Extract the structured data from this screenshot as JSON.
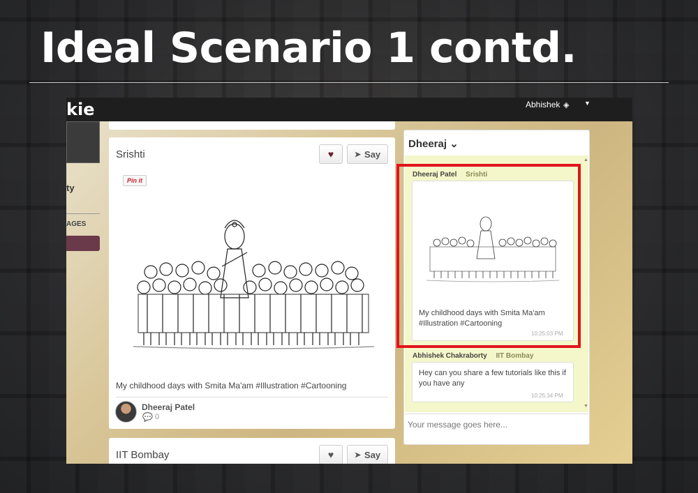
{
  "slide": {
    "title": "Ideal Scenario 1 contd."
  },
  "app": {
    "logo_text": "kie",
    "user_name": "Abhishek",
    "sidebar": {
      "label_ty": "ty",
      "label_ages": "AGES"
    }
  },
  "feed": {
    "posts": [
      {
        "group": "Srishti",
        "like_label": "♥",
        "say_label": "Say",
        "pinit_label": "Pin it",
        "caption": "My childhood days with Smita Ma'am #Illustration #Cartooning",
        "author": "Dheeraj Patel",
        "comment_count": "0"
      },
      {
        "group": "IIT Bombay",
        "like_label": "♥",
        "say_label": "Say"
      }
    ]
  },
  "chat": {
    "title": "Dheeraj",
    "messages": [
      {
        "sender": "Dheeraj Patel",
        "group": "Srishti",
        "text": "My childhood days with Smita Ma'am #Illustration #Cartooning",
        "time": "10:25:03 PM"
      },
      {
        "sender": "Abhishek Chakraborty",
        "group": "IIT Bombay",
        "text": "Hey can you share a few tutorials like this if you have any",
        "time": "10:25:34 PM"
      }
    ],
    "input_placeholder": "Your message goes here..."
  },
  "colors": {
    "highlight": "#e2141b",
    "chat_bg": "#f4f7c9",
    "like_heart": "#6b1f2f"
  }
}
